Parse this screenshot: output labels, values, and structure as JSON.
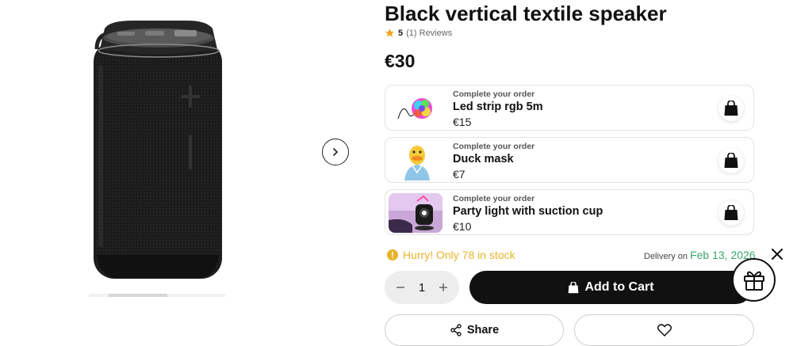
{
  "product": {
    "title": "Black vertical textile speaker",
    "rating_score": "5",
    "rating_count": "(1) Reviews",
    "price": "€30"
  },
  "upsells": [
    {
      "eyebrow": "Complete your order",
      "name": "Led strip rgb 5m",
      "price": "€15",
      "icon": "led-strip-thumb"
    },
    {
      "eyebrow": "Complete your order",
      "name": "Duck mask",
      "price": "€7",
      "icon": "duck-mask-thumb"
    },
    {
      "eyebrow": "Complete your order",
      "name": "Party light with suction cup",
      "price": "€10",
      "icon": "party-light-thumb"
    }
  ],
  "stock": {
    "message": "Hurry! Only 78 in stock"
  },
  "delivery": {
    "label": "Delivery on",
    "date": "Feb 13, 2026"
  },
  "cart": {
    "quantity": "1",
    "add_label": "Add to Cart"
  },
  "actions": {
    "share_label": "Share"
  },
  "colors": {
    "accent": "#111111",
    "stock_warning": "#e8b32b",
    "delivery_date": "#3aa86b",
    "star": "#f3a31b"
  }
}
